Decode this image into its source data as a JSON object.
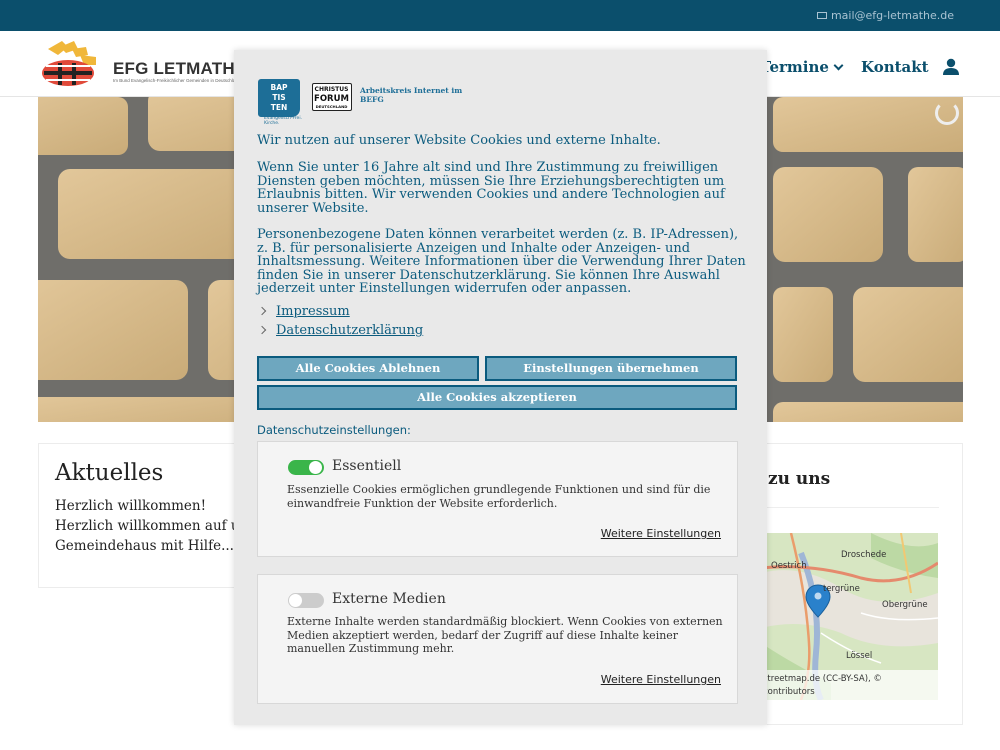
{
  "topbar": {
    "email": "mail@efg-letmathe.de"
  },
  "header": {
    "logo_text": "EFG LETMATHE",
    "logo_subtext": "Im Bund Evangelisch-Freikirchlicher Gemeinden in Deutschland K.d.ö.R.",
    "nav": {
      "termine": "Termine",
      "kontakt": "Kontakt"
    }
  },
  "main": {
    "aktuelles": {
      "title": "Aktuelles",
      "line1": "Herzlich willkommen!",
      "line2": "Herzlich willkommen auf un",
      "line3": "Gemeindehaus mit Hilfe..."
    },
    "weg": {
      "title": "zu uns",
      "map_labels": [
        "Droschede",
        "Oestrich",
        "tergrüne",
        "Obergrüne",
        "Lössel"
      ],
      "map_credit_1": "streetmap.de (CC-BY-SA), ©",
      "map_credit_2": "contributors"
    }
  },
  "cookie": {
    "logos": {
      "baptisten_lines": [
        "BAP",
        "TIS",
        "TEN"
      ],
      "baptisten_tagline": "Evangelisch-Frei. Kirche.",
      "forum_lines": [
        "CHRISTUS",
        "FORUM",
        "DEUTSCHLAND"
      ],
      "arbeitskreis": "Arbeitskreis Internet im BEFG"
    },
    "intro": "Wir nutzen auf unserer Website Cookies und externe Inhalte.",
    "para1": "Wenn Sie unter 16 Jahre alt sind und Ihre Zustimmung zu freiwilligen Diensten geben möchten, müssen Sie Ihre Erziehungsberechtigten um Erlaubnis bitten. Wir verwenden Cookies und andere Technologien auf unserer Website.",
    "para2": "Personenbezogene Daten können verarbeitet werden (z. B. IP-Adressen), z. B. für personalisierte Anzeigen und Inhalte oder Anzeigen- und Inhaltsmessung. Weitere Informationen über die Verwendung Ihrer Daten finden Sie in unserer Datenschutzerklärung. Sie können Ihre Auswahl jederzeit unter Einstellungen widerrufen oder anpassen.",
    "links": {
      "impressum": "Impressum",
      "datenschutz": "Datenschutzerklärung"
    },
    "buttons": {
      "reject": "Alle Cookies Ablehnen",
      "save": "Einstellungen übernehmen",
      "accept": "Alle Cookies akzeptieren"
    },
    "settings_label": "Datenschutzeinstellungen:",
    "essential": {
      "title": "Essentiell",
      "enabled": true,
      "desc": "Essenzielle Cookies ermöglichen grundlegende Funktionen und sind für die einwandfreie Funktion der Website erforderlich.",
      "more": "Weitere Einstellungen"
    },
    "external": {
      "title": "Externe Medien",
      "enabled": false,
      "desc": "Externe Inhalte werden standardmäßig blockiert. Wenn Cookies von externen Medien akzeptiert werden, bedarf der Zugriff auf diese Inhalte keiner manuellen Zustimmung mehr.",
      "more": "Weitere Einstellungen"
    }
  },
  "colors": {
    "brand": "#0b4f6c",
    "button_fill": "#6ea7bf",
    "toggle_on": "#3ab54a",
    "toggle_off": "#cccccc"
  }
}
